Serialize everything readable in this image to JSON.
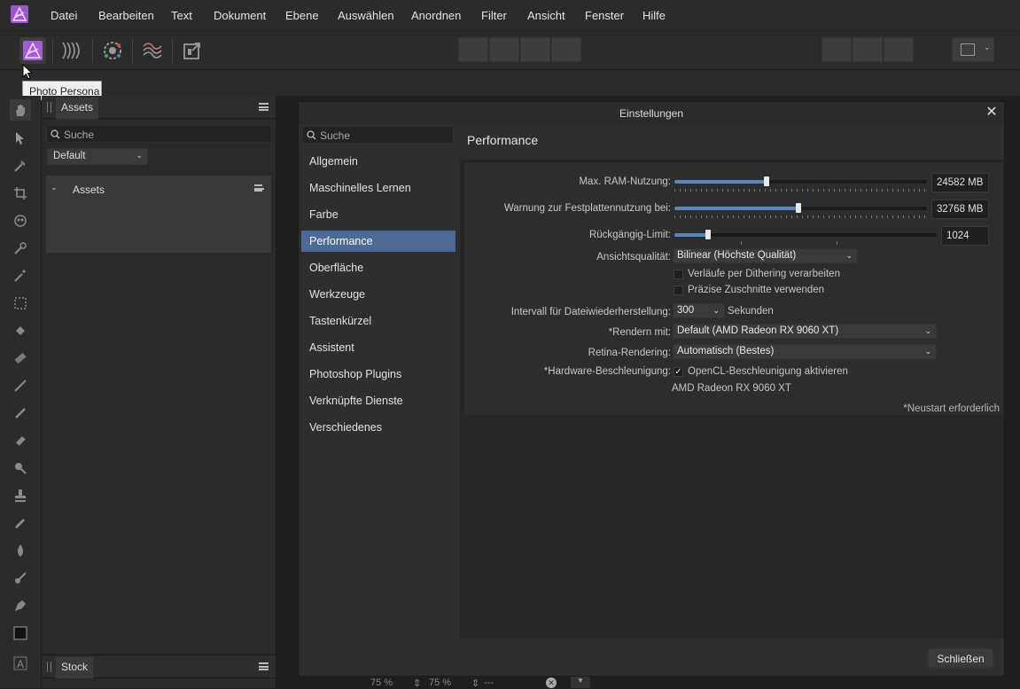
{
  "menubar": {
    "items": [
      "Datei",
      "Bearbeiten",
      "Text",
      "Dokument",
      "Ebene",
      "Auswählen",
      "Anordnen",
      "Filter",
      "Ansicht",
      "Fenster",
      "Hilfe"
    ]
  },
  "toolbar": {
    "personas": [
      "photo-persona-icon",
      "liquify-persona-icon",
      "develop-persona-icon",
      "tone-mapping-persona-icon",
      "export-persona-icon"
    ],
    "accent": "#a55ad6"
  },
  "tooltip": {
    "text": "Photo Persona"
  },
  "assets_panel": {
    "tab": "Assets",
    "search_placeholder": "Suche",
    "category": "Default",
    "group_title": "Assets"
  },
  "stock_panel": {
    "tab": "Stock"
  },
  "dialog": {
    "title": "Einstellungen",
    "search_placeholder": "Suche",
    "categories": [
      "Allgemein",
      "Maschinelles Lernen",
      "Farbe",
      "Performance",
      "Oberfläche",
      "Werkzeuge",
      "Tastenkürzel",
      "Assistent",
      "Photoshop Plugins",
      "Verknüpfte Dienste",
      "Verschiedenes"
    ],
    "selected_category": "Performance",
    "section_title": "Performance",
    "ram": {
      "label": "Max. RAM-Nutzung:",
      "value": "24582 MB",
      "fraction": 0.366
    },
    "disk": {
      "label": "Warnung zur Festplattennutzung bei:",
      "value": "32768 MB",
      "fraction": 0.49
    },
    "undo": {
      "label": "Rückgängig-Limit:",
      "value": "1024",
      "fraction": 0.13
    },
    "view_quality": {
      "label": "Ansichtsqualität:",
      "value": "Bilinear (Höchste Qualität)"
    },
    "dithering": {
      "label": "Verläufe per Dithering verarbeiten",
      "checked": false
    },
    "precise_clip": {
      "label": "Präzise Zuschnitte verwenden",
      "checked": false
    },
    "recovery": {
      "label": "Intervall für Dateiwiederherstellung:",
      "value": "300",
      "unit": "Sekunden"
    },
    "render": {
      "label": "*Rendern mit:",
      "value": "Default (AMD Radeon RX 9060 XT)"
    },
    "retina": {
      "label": "Retina-Rendering:",
      "value": "Automatisch (Bestes)"
    },
    "hwaccel": {
      "label": "*Hardware-Beschleunigung:",
      "checkbox_label": "OpenCL-Beschleunigung aktivieren",
      "checked": true,
      "device": "AMD Radeon RX 9060 XT"
    },
    "restart_note": "*Neustart erforderlich",
    "close_label": "Schließen"
  },
  "statusbar": {
    "zoom1": "75 %",
    "zoom2": "75 %",
    "value": "---"
  }
}
